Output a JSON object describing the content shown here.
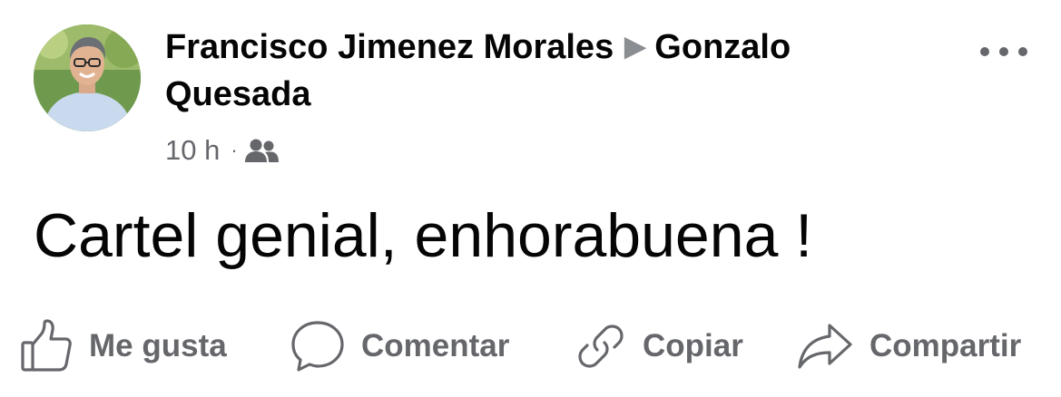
{
  "post": {
    "author": "Francisco Jimenez Morales",
    "arrow": "▶",
    "recipient": "Gonzalo Quesada",
    "time": "10 h",
    "separator": "·",
    "audience_icon": "friends-icon",
    "text": "Cartel genial, enhorabuena !"
  },
  "actions": {
    "like_label": "Me gusta",
    "comment_label": "Comentar",
    "copy_label": "Copiar",
    "share_label": "Compartir"
  },
  "icons": {
    "more": "more-dots-icon",
    "like": "thumbs-up-icon",
    "comment": "comment-bubble-icon",
    "copy": "link-icon",
    "share": "share-arrow-icon"
  },
  "colors": {
    "text_primary": "#050505",
    "text_secondary": "#65676b",
    "background": "#ffffff"
  }
}
